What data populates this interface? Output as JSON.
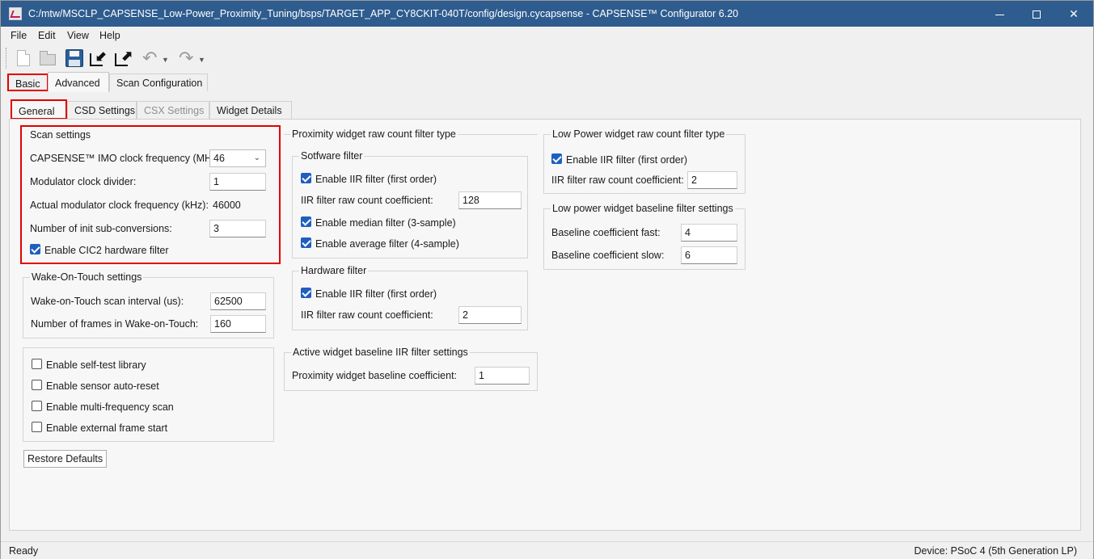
{
  "window": {
    "title": "C:/mtw/MSCLP_CAPSENSE_Low-Power_Proximity_Tuning/bsps/TARGET_APP_CY8CKIT-040T/config/design.cycapsense - CAPSENSE™ Configurator 6.20",
    "title_bar_color": "#2e5c8e"
  },
  "menu": {
    "items": [
      "File",
      "Edit",
      "View",
      "Help"
    ]
  },
  "toolbar": {
    "icons": [
      "new-document-icon",
      "open-folder-icon",
      "save-icon",
      "import-icon",
      "export-icon",
      "undo-icon",
      "redo-icon"
    ]
  },
  "main_tabs": [
    {
      "label": "Basic",
      "active": false,
      "highlighted": true
    },
    {
      "label": "Advanced",
      "active": true
    },
    {
      "label": "Scan Configuration",
      "active": false
    }
  ],
  "sub_tabs": [
    {
      "label": "General",
      "active": true,
      "highlighted": true
    },
    {
      "label": "CSD Settings",
      "active": false
    },
    {
      "label": "CSX Settings",
      "disabled": true
    },
    {
      "label": "Widget Details",
      "active": false
    }
  ],
  "highlight_color": "#e10000",
  "scan_settings": {
    "title": "Scan settings",
    "imo_label": "CAPSENSE™ IMO clock frequency (MHz):",
    "imo_value": "46",
    "mod_div_label": "Modulator clock divider:",
    "mod_div_value": "1",
    "actual_mod_label": "Actual modulator clock frequency (kHz):",
    "actual_mod_value": "46000",
    "init_sub_label": "Number of init sub-conversions:",
    "init_sub_value": "3",
    "cic2_label": "Enable CIC2 hardware filter",
    "cic2_checked": true
  },
  "wot_settings": {
    "title": "Wake-On-Touch settings",
    "interval_label": "Wake-on-Touch scan interval (us):",
    "interval_value": "62500",
    "frames_label": "Number of frames in Wake-on-Touch:",
    "frames_value": "160"
  },
  "misc_options": [
    {
      "label": "Enable self-test library",
      "checked": false
    },
    {
      "label": "Enable sensor auto-reset",
      "checked": false
    },
    {
      "label": "Enable multi-frequency scan",
      "checked": false
    },
    {
      "label": "Enable external frame start",
      "checked": false
    }
  ],
  "restore_defaults": "Restore Defaults",
  "prox_filter": {
    "title": "Proximity widget raw count filter type",
    "software": {
      "title": "Sotfware filter",
      "iir_label": "Enable IIR filter (first order)",
      "iir_checked": true,
      "coef_label": "IIR filter raw count coefficient:",
      "coef_value": "128",
      "median_label": "Enable median filter (3-sample)",
      "median_checked": true,
      "average_label": "Enable average filter (4-sample)",
      "average_checked": true
    },
    "hardware": {
      "title": "Hardware filter",
      "iir_label": "Enable IIR filter (first order)",
      "iir_checked": true,
      "coef_label": "IIR filter raw count coefficient:",
      "coef_value": "2"
    }
  },
  "active_baseline": {
    "title": "Active widget baseline IIR filter settings",
    "coef_label": "Proximity widget baseline coefficient:",
    "coef_value": "1"
  },
  "lp_filter": {
    "title": "Low Power widget raw count filter type",
    "iir_label": "Enable IIR filter (first order)",
    "iir_checked": true,
    "coef_label": "IIR filter raw count coefficient:",
    "coef_value": "2"
  },
  "lp_baseline": {
    "title": "Low power widget baseline filter settings",
    "fast_label": "Baseline coefficient fast:",
    "fast_value": "4",
    "slow_label": "Baseline coefficient slow:",
    "slow_value": "6"
  },
  "status": {
    "left": "Ready",
    "right": "Device: PSoC 4 (5th Generation LP)"
  }
}
